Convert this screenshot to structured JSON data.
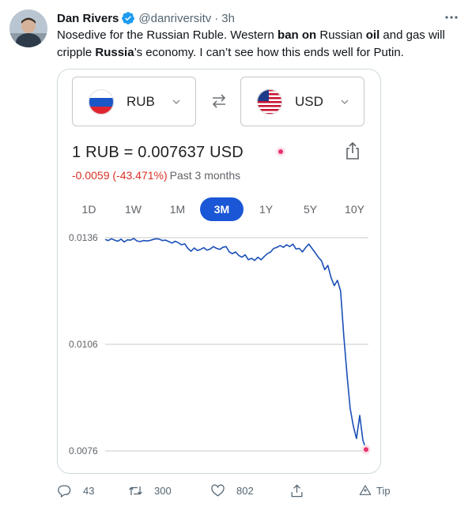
{
  "tweet": {
    "author_name": "Dan Rivers",
    "handle": "@danriversitv",
    "separator": "·",
    "time": "3h",
    "text_parts": [
      {
        "t": "Nosedive for the Russian  Ruble. Western ",
        "b": false
      },
      {
        "t": "ban on",
        "b": true
      },
      {
        "t": " Russian ",
        "b": false
      },
      {
        "t": "oil",
        "b": true
      },
      {
        "t": " and gas will cripple ",
        "b": false
      },
      {
        "t": "Russia",
        "b": true
      },
      {
        "t": "’s economy. I can’t see how this ends well for Putin.",
        "b": false
      }
    ]
  },
  "card": {
    "from_currency": "RUB",
    "to_currency": "USD",
    "rate_text": "1 RUB = 0.007637 USD",
    "change_text": "-0.0059 (-43.471%)",
    "period_text": "Past 3 months",
    "tabs": [
      {
        "label": "1D",
        "active": false
      },
      {
        "label": "1W",
        "active": false
      },
      {
        "label": "1M",
        "active": false
      },
      {
        "label": "3M",
        "active": true
      },
      {
        "label": "1Y",
        "active": false
      },
      {
        "label": "5Y",
        "active": false
      },
      {
        "label": "10Y",
        "active": false
      }
    ],
    "colors": {
      "accent": "#1a57d6",
      "negative": "#d93025",
      "line": "#1a4fb8",
      "marker": "#e8336d"
    }
  },
  "chart_data": {
    "type": "line",
    "title": "",
    "xlabel": "",
    "ylabel": "",
    "ylim": [
      0.0074,
      0.0138
    ],
    "y_ticks": [
      0.0136,
      0.0106,
      0.0076
    ],
    "y_tick_labels": [
      "0.0136",
      "0.0106",
      "0.0076"
    ],
    "grid": true,
    "series": [
      {
        "values": [
          0.01355,
          0.01352,
          0.01357,
          0.01353,
          0.0135,
          0.01356,
          0.01348,
          0.01354,
          0.01353,
          0.01358,
          0.01351,
          0.01349,
          0.01352,
          0.01351,
          0.01352,
          0.01355,
          0.01357,
          0.01356,
          0.01352,
          0.01353,
          0.01349,
          0.01345,
          0.0135,
          0.01346,
          0.0134,
          0.01343,
          0.0133,
          0.01322,
          0.01331,
          0.01324,
          0.01327,
          0.01332,
          0.01325,
          0.01328,
          0.01335,
          0.0133,
          0.01327,
          0.01333,
          0.01335,
          0.0132,
          0.01315,
          0.0132,
          0.0131,
          0.01305,
          0.01312,
          0.01298,
          0.01302,
          0.01296,
          0.01305,
          0.01298,
          0.01307,
          0.01315,
          0.0132,
          0.0133,
          0.01333,
          0.01338,
          0.01333,
          0.0134,
          0.01335,
          0.01342,
          0.01328,
          0.0133,
          0.0132,
          0.01332,
          0.01342,
          0.0133,
          0.01318,
          0.01305,
          0.01295,
          0.0127,
          0.01282,
          0.01248,
          0.01225,
          0.0124,
          0.0121,
          0.01085,
          0.00975,
          0.0088,
          0.0083,
          0.00795,
          0.0086,
          0.0079,
          0.00764
        ]
      }
    ]
  },
  "actions": {
    "reply_count": "43",
    "retweet_count": "300",
    "like_count": "802",
    "tip_label": "Tip"
  }
}
